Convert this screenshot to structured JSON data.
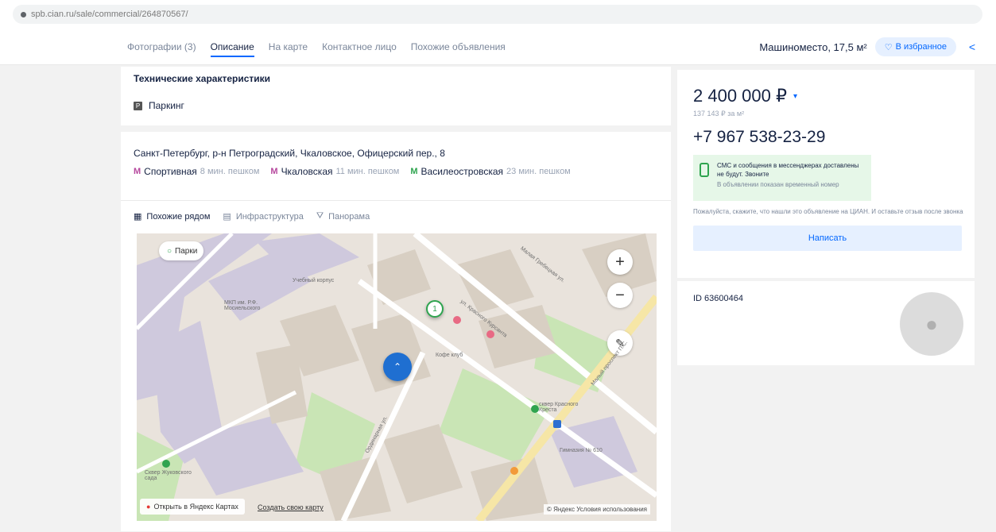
{
  "browser": {
    "url": "spb.cian.ru/sale/commercial/264870567/"
  },
  "nav": {
    "tabs": [
      {
        "label": "Фотографии (3)"
      },
      {
        "label": "Описание"
      },
      {
        "label": "На карте"
      },
      {
        "label": "Контактное лицо"
      },
      {
        "label": "Похожие объявления"
      }
    ],
    "title": "Машиноместо, 17,5 м²",
    "favorite_label": "В избранное"
  },
  "tech": {
    "title": "Технические характеристики",
    "item": "Паркинг"
  },
  "address": {
    "text": "Санкт-Петербург, р-н Петроградский, Чкаловское, Офицерский пер., 8",
    "metros": [
      {
        "name": "Спортивная",
        "time": "8 мин. пешком",
        "color": "#b6489e"
      },
      {
        "name": "Чкаловская",
        "time": "11 мин. пешком",
        "color": "#b6489e"
      },
      {
        "name": "Василеостровская",
        "time": "23 мин. пешком",
        "color": "#2fa44f"
      }
    ]
  },
  "map_tabs": [
    {
      "label": "Похожие рядом"
    },
    {
      "label": "Инфраструктура"
    },
    {
      "label": "Панорама"
    }
  ],
  "map": {
    "park_filter": "Парки",
    "open_label": "Открыть в Яндекс Картах",
    "create_label": "Создать свою карту",
    "yandex_label": "© Яндекс Условия использования",
    "labels": {
      "u1": "Учебный корпус",
      "u2": "МКП им. Р.Ф. Мосиельского",
      "cafe": "Кофе клуб",
      "square": "сквер Красного Креста",
      "school": "Гимназия № 610",
      "garden": "Сквер Жуковского сада",
      "street1": "Малая Гребецкая ул.",
      "street2": "ул. Красного Курсанта",
      "street3": "Малый проспект П.С.",
      "street4": "Ординарная ул.",
      "cluster": "1"
    }
  },
  "price": {
    "value": "2 400 000 ₽",
    "per_meter": "137 143 ₽ за м²",
    "phone": "+7 967 538-23-29",
    "sms_text": "СМС и сообщения в мессенджерах доставлены не будут. Звоните",
    "sms_sub": "В объявлении показан временный номер",
    "note": "Пожалуйста, скажите, что нашли это объявление на ЦИАН. И оставьте отзыв после звонка",
    "write_label": "Написать"
  },
  "listing": {
    "id": "ID 63600464"
  },
  "colors": {
    "accent": "#0468ff",
    "text": "#152242",
    "bg": "#f2f2f2"
  }
}
